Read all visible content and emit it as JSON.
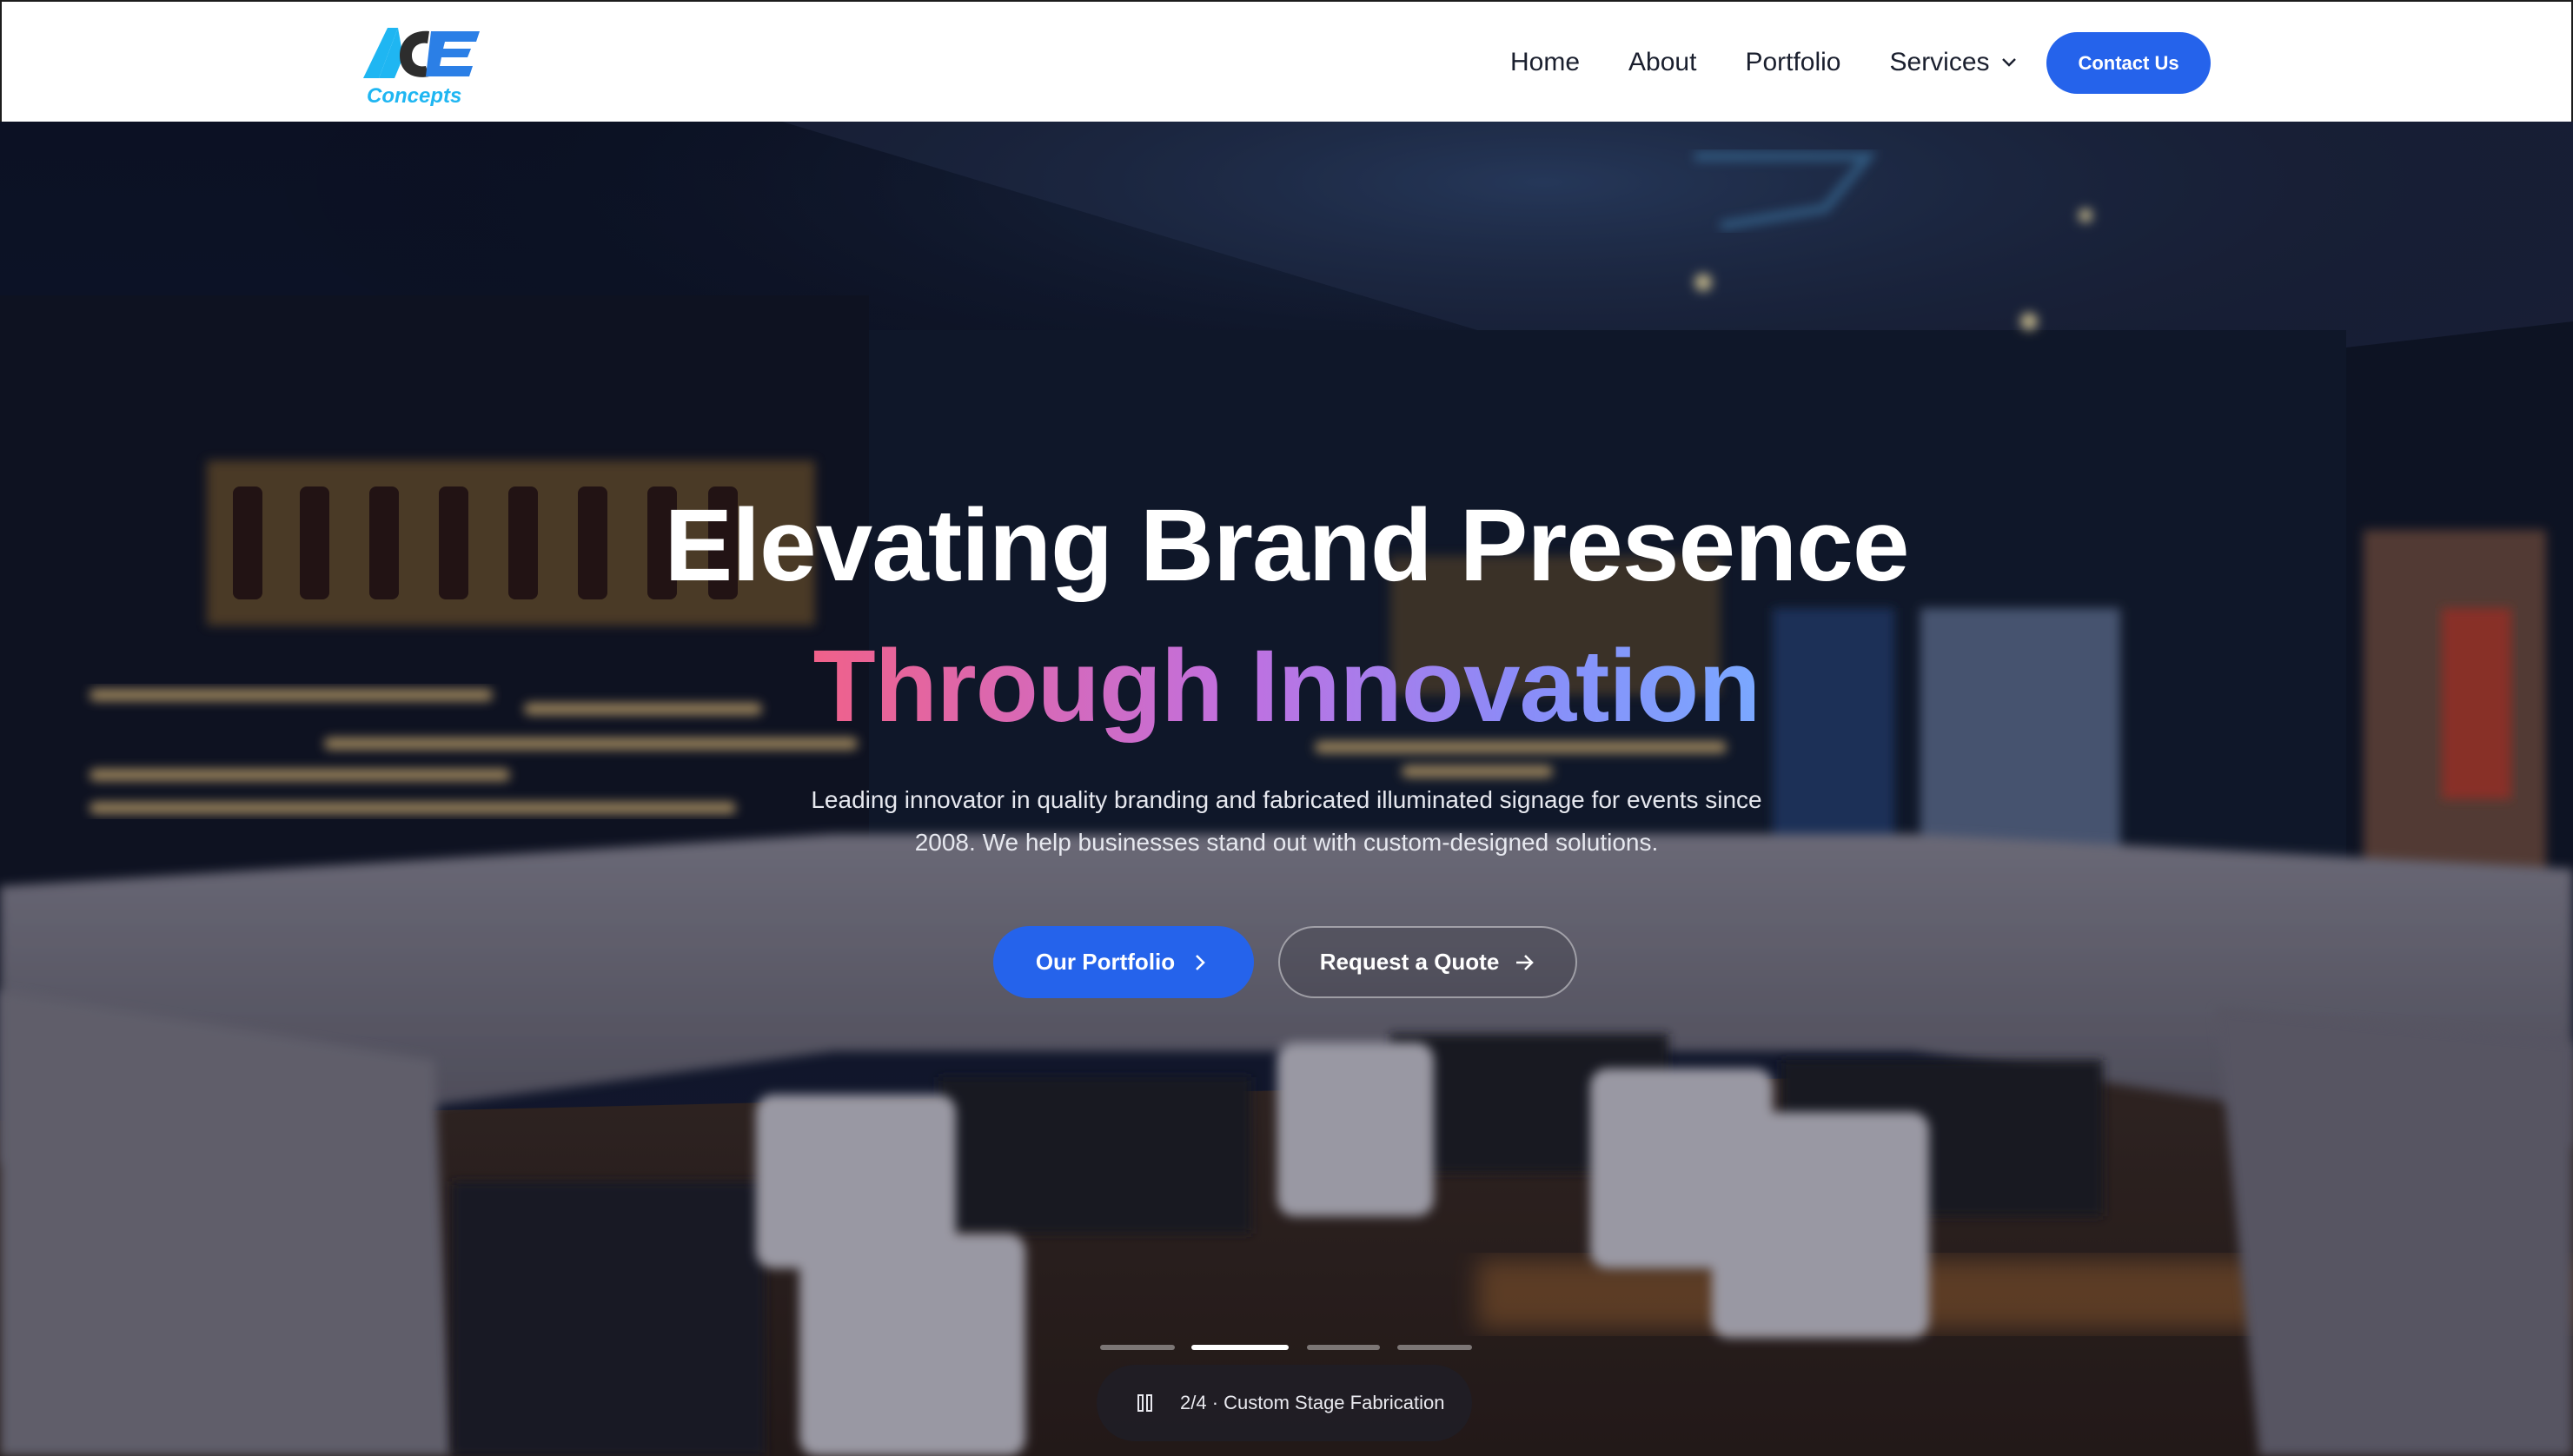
{
  "nav": {
    "logo_text_main": "ACE",
    "logo_text_sub": "Concepts",
    "links": [
      {
        "label": "Home"
      },
      {
        "label": "About"
      },
      {
        "label": "Portfolio"
      },
      {
        "label": "Services"
      }
    ],
    "contact_label": "Contact Us"
  },
  "hero": {
    "title_line1": "Elevating Brand Presence",
    "title_line2": "Through Innovation",
    "description": "Leading innovator in quality branding and fabricated illuminated signage for events since 2008. We help businesses stand out with custom-designed solutions.",
    "primary_button": "Our Portfolio",
    "secondary_button": "Request a Quote",
    "slide_current": 2,
    "slide_total": 4,
    "slide_status": "2/4 · Custom Stage Fabrication"
  },
  "colors": {
    "accent": "#2563eb",
    "gradient_start": "#f0618a",
    "gradient_end": "#7aa8ff"
  },
  "icons": {
    "services_dropdown": "chevron-down-icon",
    "primary_button": "chevron-right-icon",
    "secondary_button": "arrow-right-icon",
    "slide_control": "pause-icon"
  }
}
